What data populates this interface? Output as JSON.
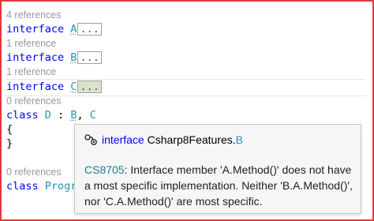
{
  "editor": {
    "lines": [
      {
        "kind": "lens",
        "text": "4 references"
      },
      {
        "kind": "interface",
        "keyword": "interface",
        "name": "A",
        "collapsed": "..."
      },
      {
        "kind": "lens",
        "text": "1 reference"
      },
      {
        "kind": "interface",
        "keyword": "interface",
        "name": "B",
        "collapsed": "..."
      },
      {
        "kind": "lens",
        "text": "1 reference"
      },
      {
        "kind": "interface",
        "keyword": "interface",
        "name": "C",
        "collapsed": "..."
      },
      {
        "kind": "lens",
        "text": "0 references"
      },
      {
        "kind": "class",
        "keyword": "class",
        "name": "D",
        "colon": " : ",
        "base1": "B",
        "comma": ", ",
        "base2": "C"
      },
      {
        "kind": "brace",
        "text": "{"
      },
      {
        "kind": "brace",
        "text": "}"
      },
      {
        "kind": "lens",
        "text": "0 references"
      },
      {
        "kind": "class2",
        "keyword": "class",
        "name": "Progr"
      }
    ]
  },
  "tooltip": {
    "icon": "interface-icon",
    "header": {
      "keyword": "interface",
      "namespace": "Csharp8Features.",
      "type": "B"
    },
    "error_code": "CS8705",
    "message": ": Interface member 'A.Method()' does not have a most specific implementation. Neither 'B.A.Method()', nor 'C.A.Method()' are most specific."
  }
}
